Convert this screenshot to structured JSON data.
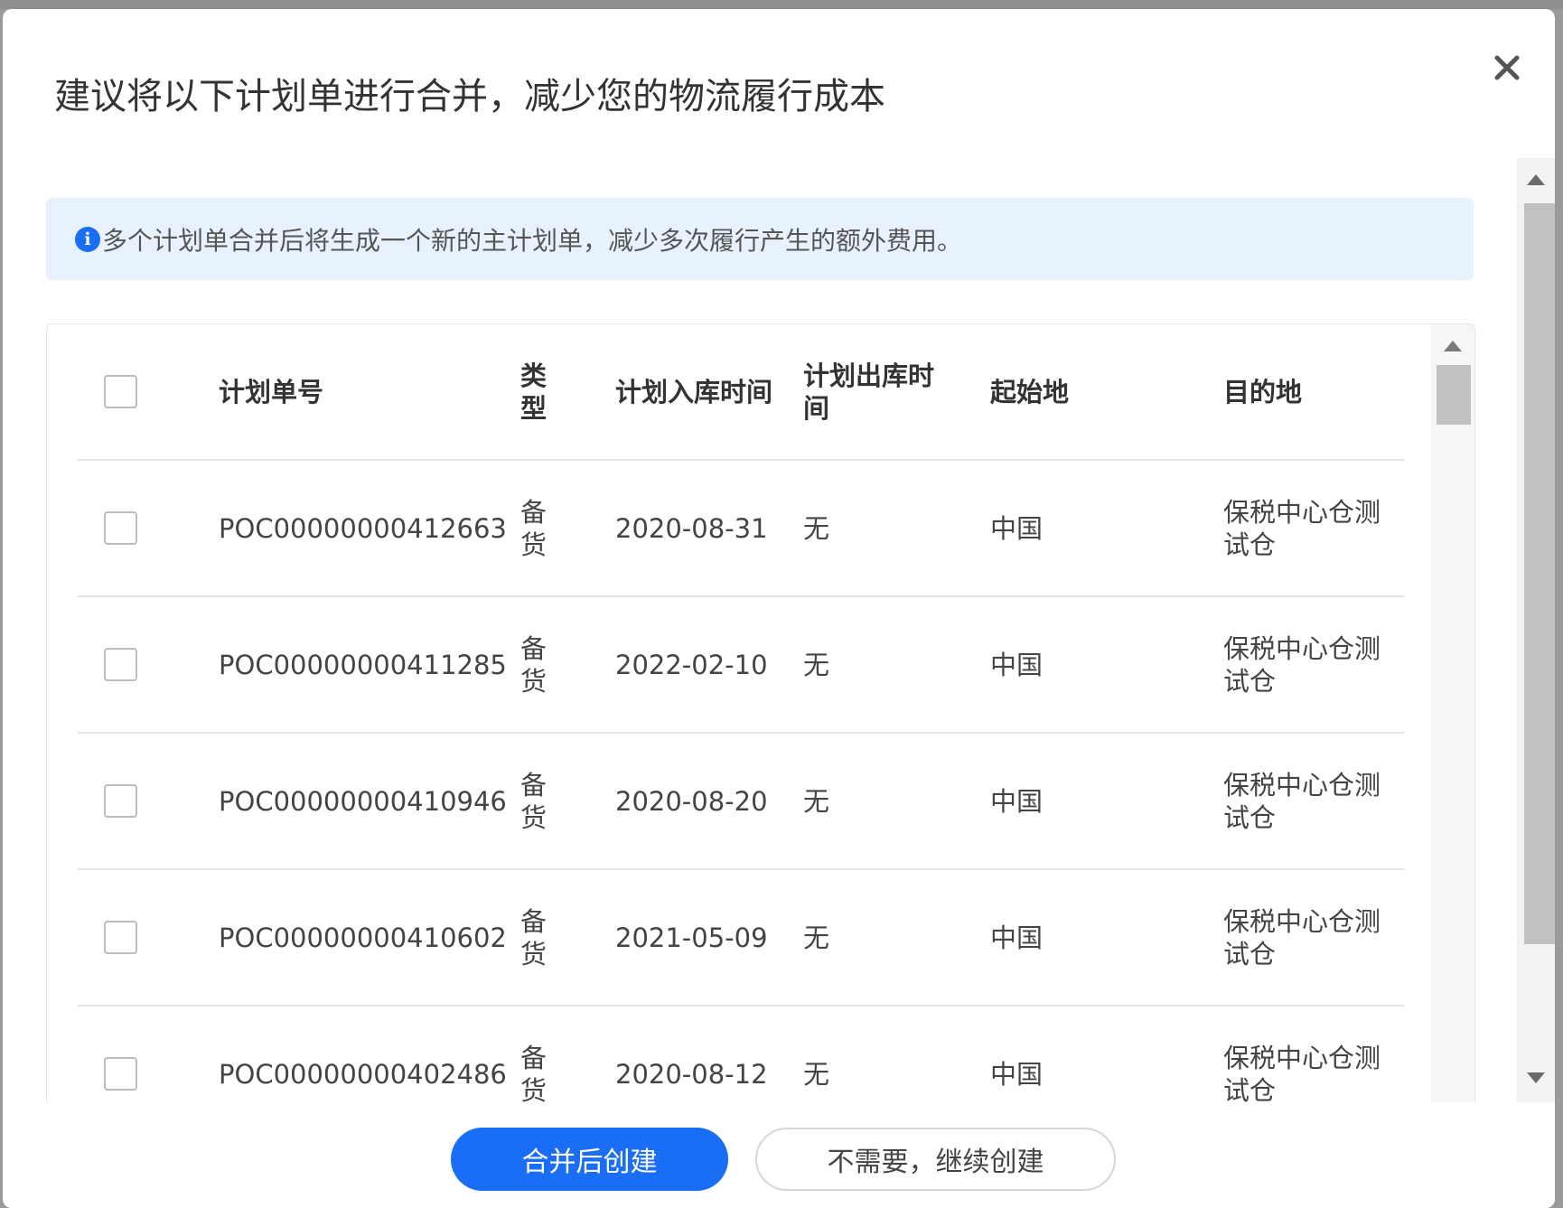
{
  "dialog": {
    "title": "建议将以下计划单进行合并，减少您的物流履行成本",
    "close_icon": "close-icon"
  },
  "banner": {
    "icon": "info-icon",
    "icon_glyph": "i",
    "text": "多个计划单合并后将生成一个新的主计划单，减少多次履行产生的额外费用。"
  },
  "table": {
    "columns": {
      "plan_no": "计划单号",
      "type": "类型",
      "inbound": "计划入库时间",
      "outbound": "计划出库时间",
      "origin": "起始地",
      "destination": "目的地"
    },
    "rows": [
      {
        "plan_no": "POC00000000412663",
        "type": "备货",
        "inbound": "2020-08-31",
        "outbound": "无",
        "origin": "中国",
        "destination": "保税中心仓测试仓"
      },
      {
        "plan_no": "POC00000000411285",
        "type": "备货",
        "inbound": "2022-02-10",
        "outbound": "无",
        "origin": "中国",
        "destination": "保税中心仓测试仓"
      },
      {
        "plan_no": "POC00000000410946",
        "type": "备货",
        "inbound": "2020-08-20",
        "outbound": "无",
        "origin": "中国",
        "destination": "保税中心仓测试仓"
      },
      {
        "plan_no": "POC00000000410602",
        "type": "备货",
        "inbound": "2021-05-09",
        "outbound": "无",
        "origin": "中国",
        "destination": "保税中心仓测试仓"
      },
      {
        "plan_no": "POC00000000402486",
        "type": "备货",
        "inbound": "2020-08-12",
        "outbound": "无",
        "origin": "中国",
        "destination": "保税中心仓测试仓"
      }
    ]
  },
  "footer": {
    "merge_label": "合并后创建",
    "skip_label": "不需要，继续创建"
  },
  "colors": {
    "primary": "#1a6ef5",
    "banner_bg": "#e8f2fd"
  }
}
